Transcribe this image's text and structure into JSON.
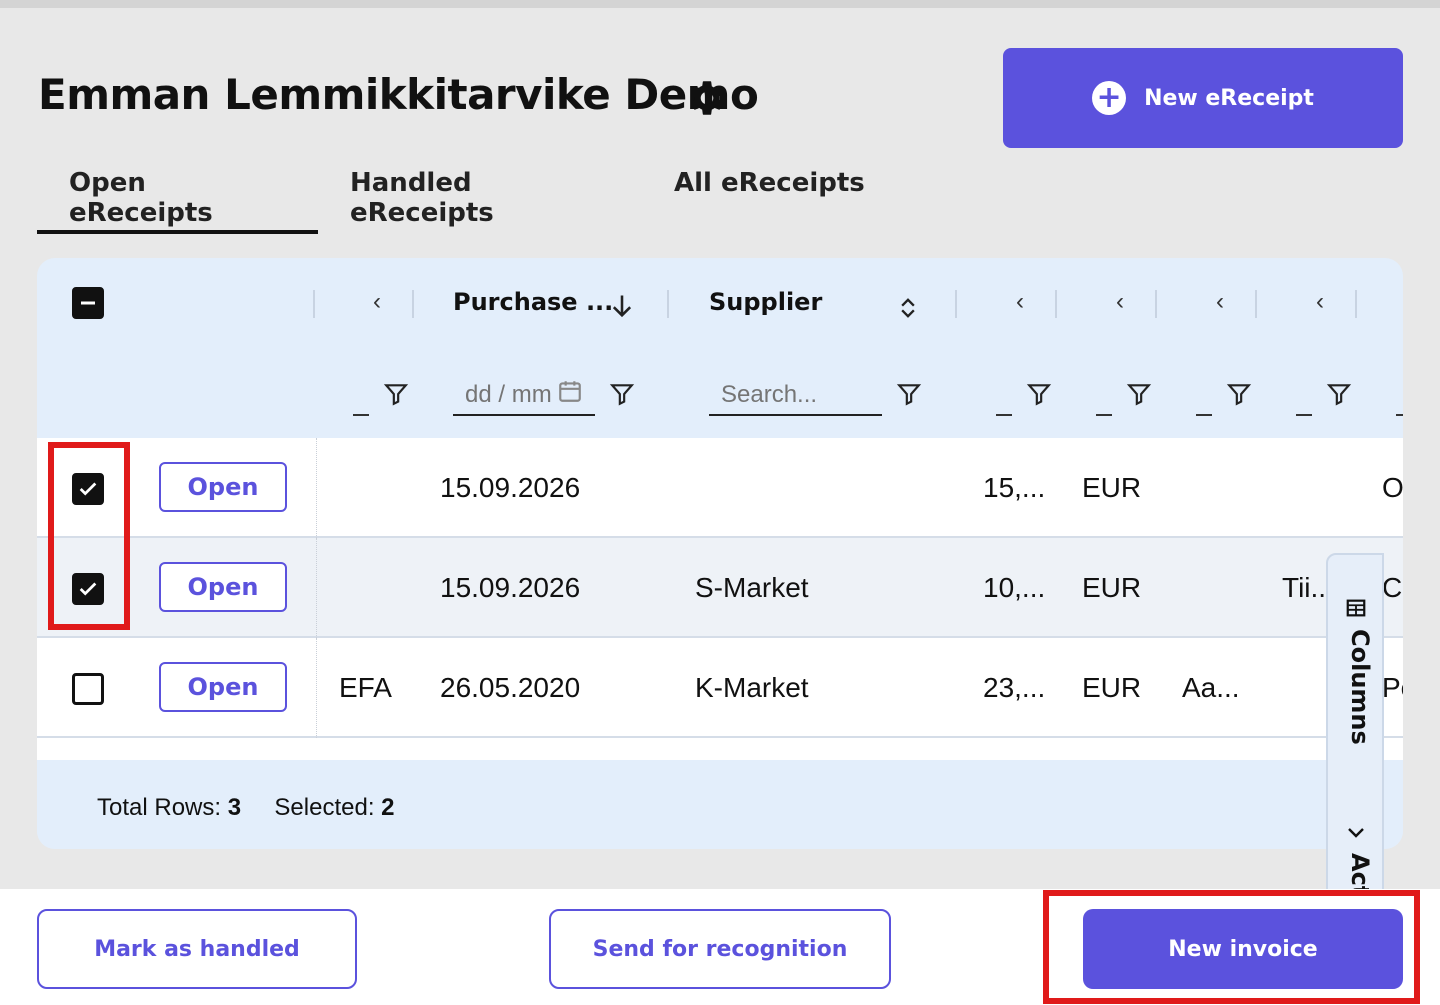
{
  "page": {
    "title": "Emman Lemmikkitarvike Demo",
    "settings_icon": "gear-icon"
  },
  "actions": {
    "new_ereceipt_label": "New eReceipt",
    "new_ereceipt_icon": "plus-circle-icon"
  },
  "tabs": [
    {
      "label": "Open eReceipts",
      "active": true
    },
    {
      "label": "Handled eReceipts",
      "active": false
    },
    {
      "label": "All eReceipts",
      "active": false
    }
  ],
  "grid": {
    "columns": {
      "purchase_date": "Purchase ...",
      "supplier": "Supplier"
    },
    "filters": {
      "date_placeholder": "dd / mm",
      "supplier_placeholder": "Search..."
    },
    "open_label": "Open",
    "rows": [
      {
        "checked": true,
        "code": "",
        "date": "15.09.2026",
        "supplier": "",
        "amount": "15,...",
        "currency": "EUR",
        "col_a": "",
        "col_b": "",
        "col_c": "O"
      },
      {
        "checked": true,
        "code": "",
        "date": "15.09.2026",
        "supplier": "S-Market",
        "amount": "10,...",
        "currency": "EUR",
        "col_a": "",
        "col_b": "Tii...",
        "col_c": "Co"
      },
      {
        "checked": false,
        "code": "EFA",
        "date": "26.05.2020",
        "supplier": "K-Market",
        "amount": "23,...",
        "currency": "EUR",
        "col_a": "Aa...",
        "col_b": "",
        "col_c": "Pe"
      }
    ],
    "footer": {
      "total_label": "Total Rows:",
      "total_value": "3",
      "selected_label": "Selected:",
      "selected_value": "2"
    },
    "side_panel": {
      "columns_label": "Columns",
      "actions_label": "Actions"
    }
  },
  "bottom_actions": {
    "mark_handled": "Mark as handled",
    "send_recognition": "Send for recognition",
    "new_invoice": "New invoice"
  },
  "colors": {
    "accent": "#5b52dd",
    "grid_bg": "#e3eefb",
    "highlight": "#e01a1a"
  }
}
